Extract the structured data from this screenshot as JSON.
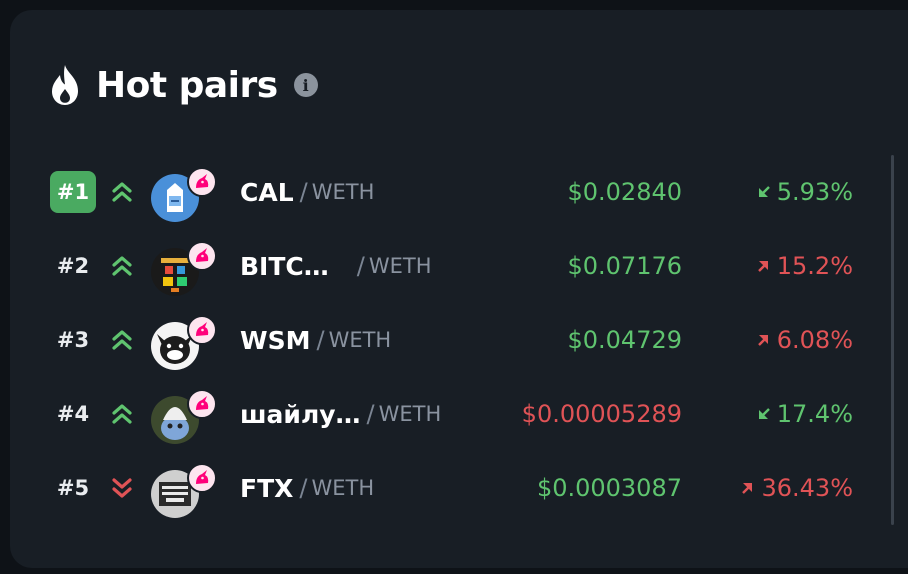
{
  "header": {
    "title": "Hot pairs",
    "info_glyph": "i"
  },
  "colors": {
    "up": "#5fc46f",
    "down": "#e05356",
    "rank_highlight": "#4aaa61",
    "card": "#181e25"
  },
  "pairs": [
    {
      "rank": "#1",
      "trend": "up",
      "symbol": "CAL",
      "quote": "WETH",
      "price": "$0.02840",
      "price_color": "green",
      "change": "5.93%",
      "change_dir": "up",
      "avatar": "milk-carton-avatar",
      "dex": "uniswap-icon"
    },
    {
      "rank": "#2",
      "trend": "up",
      "symbol": "BITC…",
      "quote": "WETH",
      "price": "$0.07176",
      "price_color": "green",
      "change": "15.2%",
      "change_dir": "down",
      "avatar": "pixel-art-avatar",
      "dex": "uniswap-icon"
    },
    {
      "rank": "#3",
      "trend": "up",
      "symbol": "WSM",
      "quote": "WETH",
      "price": "$0.04729",
      "price_color": "green",
      "change": "6.08%",
      "change_dir": "down",
      "avatar": "bull-mascot-avatar",
      "dex": "uniswap-icon"
    },
    {
      "rank": "#4",
      "trend": "up",
      "symbol": "шайлу…",
      "quote": "WETH",
      "price": "$0.00005289",
      "price_color": "red",
      "change": "17.4%",
      "change_dir": "up",
      "avatar": "smurf-cat-avatar",
      "dex": "uniswap-icon"
    },
    {
      "rank": "#5",
      "trend": "down",
      "symbol": "FTX",
      "quote": "WETH",
      "price": "$0.0003087",
      "price_color": "green",
      "change": "36.43%",
      "change_dir": "down",
      "avatar": "hairy-plotter-ftx-avatar",
      "dex": "uniswap-icon"
    }
  ]
}
